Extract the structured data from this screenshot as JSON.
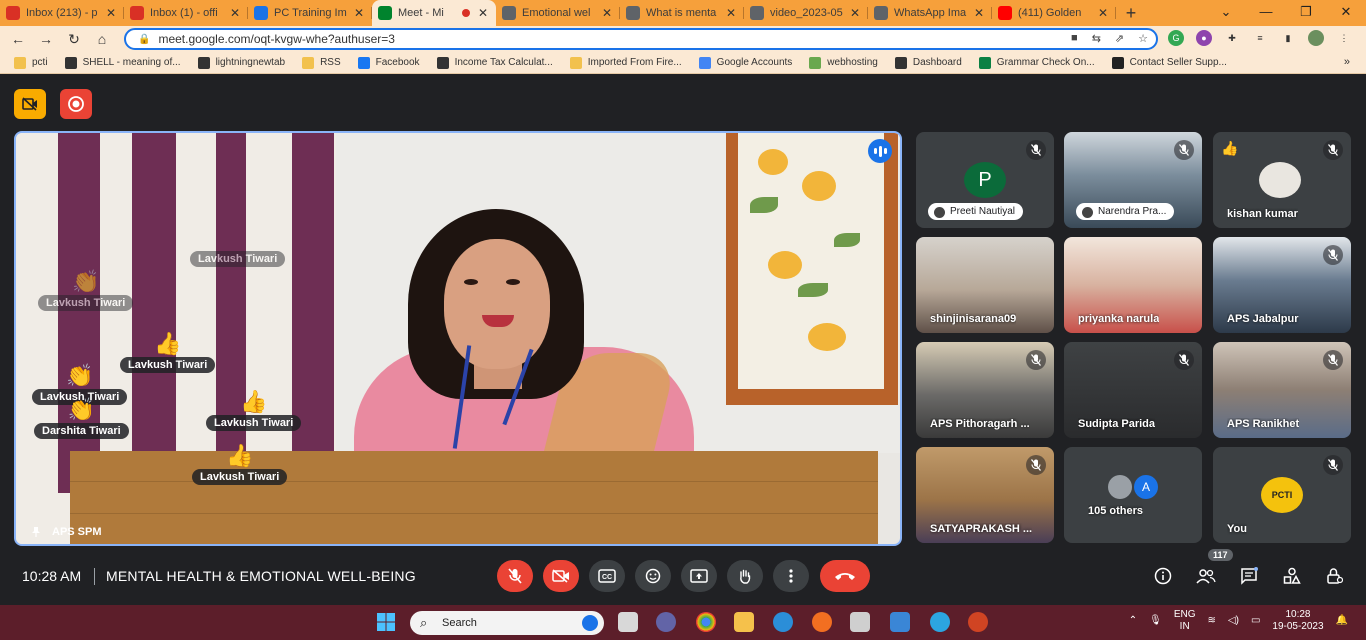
{
  "browser": {
    "tabs": [
      {
        "title": "Inbox (213) - p",
        "icon": "gmail-icon",
        "color": "#d93025"
      },
      {
        "title": "Inbox (1) - offi",
        "icon": "gmail-icon",
        "color": "#d93025"
      },
      {
        "title": "PC Training Im",
        "icon": "doc-icon",
        "color": "#1a73e8"
      },
      {
        "title": "Meet - Mi",
        "icon": "meet-icon",
        "color": "#00832d",
        "active": true,
        "recording": true
      },
      {
        "title": "Emotional wel",
        "icon": "globe-icon",
        "color": "#5f6368"
      },
      {
        "title": "What is menta",
        "icon": "globe-icon",
        "color": "#5f6368"
      },
      {
        "title": "video_2023-05",
        "icon": "globe-icon",
        "color": "#5f6368"
      },
      {
        "title": "WhatsApp Ima",
        "icon": "globe-icon",
        "color": "#5f6368"
      },
      {
        "title": "(411) Golden",
        "icon": "youtube-icon",
        "color": "#ff0000"
      }
    ],
    "url": "meet.google.com/oqt-kvgw-whe?authuser=3",
    "bookmarks": [
      {
        "label": "pcti",
        "color": "#f2c14e"
      },
      {
        "label": "SHELL - meaning of...",
        "color": "#333333"
      },
      {
        "label": "lightningnewtab",
        "color": "#333333"
      },
      {
        "label": "RSS",
        "color": "#f2c14e"
      },
      {
        "label": "Facebook",
        "color": "#1877f2"
      },
      {
        "label": "Income Tax Calculat...",
        "color": "#333333"
      },
      {
        "label": "Imported From Fire...",
        "color": "#f2c14e"
      },
      {
        "label": "Google Accounts",
        "color": "#4285f4"
      },
      {
        "label": "webhosting",
        "color": "#6aa84f"
      },
      {
        "label": "Dashboard",
        "color": "#333333"
      },
      {
        "label": "Grammar Check On...",
        "color": "#0b8043"
      },
      {
        "label": "Contact Seller Supp...",
        "color": "#222222"
      }
    ]
  },
  "meet": {
    "main": {
      "name": "APS SPM",
      "reactions": [
        {
          "emoji": "👏",
          "name": "Lavkush Tiwari",
          "faded": true
        },
        {
          "emoji": "",
          "name": "Lavkush Tiwari",
          "faded": true
        },
        {
          "emoji": "👍",
          "name": "Lavkush Tiwari"
        },
        {
          "emoji": "👏",
          "name": "Lavkush Tiwari"
        },
        {
          "emoji": "👏",
          "name": "Darshita Tiwari"
        },
        {
          "emoji": "👍",
          "name": "Lavkush Tiwari"
        },
        {
          "emoji": "👍",
          "name": "Lavkush Tiwari"
        }
      ]
    },
    "tiles": [
      {
        "name": "Preeti Nautiyal",
        "type": "pill",
        "initial": "P"
      },
      {
        "name": "Narendra Pra...",
        "type": "pill"
      },
      {
        "name": "kishan kumar",
        "reaction": "👍"
      },
      {
        "name": "shinjinisarana09"
      },
      {
        "name": "priyanka narula"
      },
      {
        "name": "APS Jabalpur"
      },
      {
        "name": "APS Pithoragarh ..."
      },
      {
        "name": "Sudipta Parida"
      },
      {
        "name": "APS Ranikhet"
      },
      {
        "name": "SATYAPRAKASH ..."
      },
      {
        "name": "105 others",
        "initial": "A"
      },
      {
        "name": "You",
        "logo": "PCTI"
      }
    ],
    "time": "10:28 AM",
    "meeting_title": "MENTAL HEALTH & EMOTIONAL WELL-BEING",
    "participant_count": "117"
  },
  "taskbar": {
    "search_placeholder": "Search",
    "lang": "ENG",
    "region": "IN",
    "time": "10:28",
    "date": "19-05-2023"
  }
}
